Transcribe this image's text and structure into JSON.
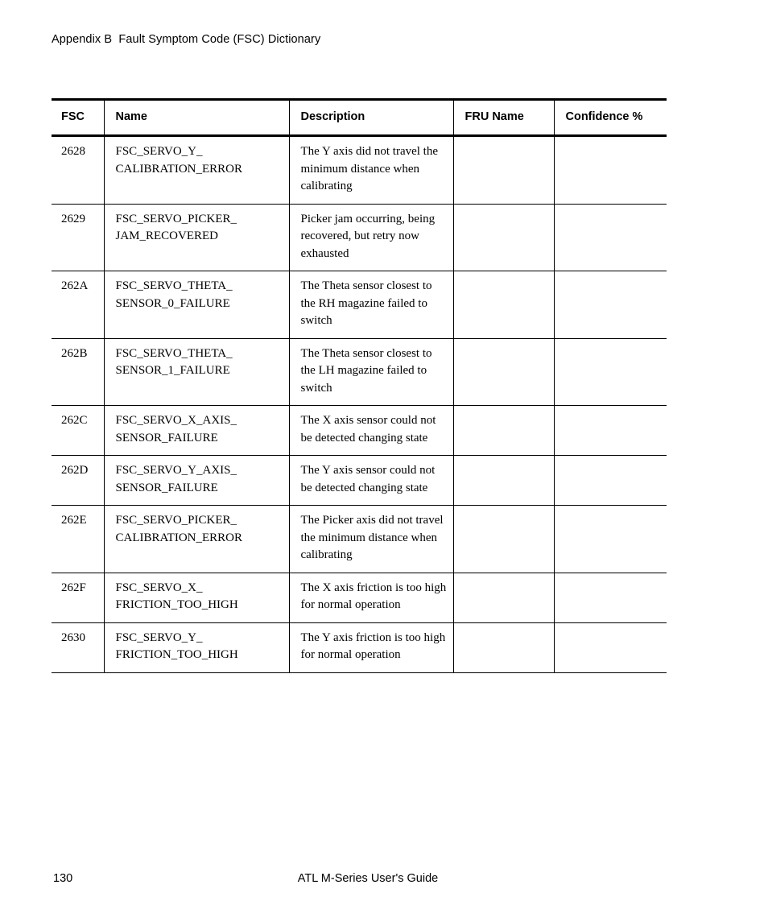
{
  "running_head": "Appendix B  Fault Symptom Code (FSC) Dictionary",
  "table": {
    "columns": [
      {
        "key": "fsc",
        "label": "FSC"
      },
      {
        "key": "name",
        "label": "Name"
      },
      {
        "key": "description",
        "label": "Description"
      },
      {
        "key": "fru_name",
        "label": "FRU Name"
      },
      {
        "key": "confidence",
        "label": "Confidence %"
      }
    ],
    "rows": [
      {
        "fsc": "2628",
        "name_lines": [
          "FSC_SERVO_Y_",
          "CALIBRATION_ERROR"
        ],
        "description": "The Y axis did not travel the minimum distance when calibrating",
        "fru_name": "",
        "confidence": ""
      },
      {
        "fsc": "2629",
        "name_lines": [
          "FSC_SERVO_PICKER_",
          "JAM_RECOVERED"
        ],
        "description": "Picker jam occurring, being recovered, but retry now exhausted",
        "fru_name": "",
        "confidence": ""
      },
      {
        "fsc": "262A",
        "name_lines": [
          "FSC_SERVO_THETA_",
          "SENSOR_0_FAILURE"
        ],
        "description": "The Theta sensor closest to the RH magazine failed to switch",
        "fru_name": "",
        "confidence": ""
      },
      {
        "fsc": "262B",
        "name_lines": [
          "FSC_SERVO_THETA_",
          "SENSOR_1_FAILURE"
        ],
        "description": "The Theta sensor closest to the LH magazine failed to switch",
        "fru_name": "",
        "confidence": ""
      },
      {
        "fsc": "262C",
        "name_lines": [
          "FSC_SERVO_X_AXIS_",
          "SENSOR_FAILURE"
        ],
        "description": "The X axis sensor could not be detected changing state",
        "fru_name": "",
        "confidence": ""
      },
      {
        "fsc": "262D",
        "name_lines": [
          "FSC_SERVO_Y_AXIS_",
          "SENSOR_FAILURE"
        ],
        "description": "The Y axis sensor could not be detected changing state",
        "fru_name": "",
        "confidence": ""
      },
      {
        "fsc": "262E",
        "name_lines": [
          "FSC_SERVO_PICKER_",
          "CALIBRATION_ERROR"
        ],
        "description": "The Picker axis did not travel the minimum distance when calibrating",
        "fru_name": "",
        "confidence": ""
      },
      {
        "fsc": "262F",
        "name_lines": [
          "FSC_SERVO_X_",
          "FRICTION_TOO_HIGH"
        ],
        "description": "The X axis friction is too high for normal operation",
        "fru_name": "",
        "confidence": ""
      },
      {
        "fsc": "2630",
        "name_lines": [
          "FSC_SERVO_Y_",
          "FRICTION_TOO_HIGH"
        ],
        "description": "The Y axis friction is too high for normal operation",
        "fru_name": "",
        "confidence": ""
      }
    ]
  },
  "footer": {
    "page_number": "130",
    "book_title": "ATL M-Series User's Guide"
  }
}
